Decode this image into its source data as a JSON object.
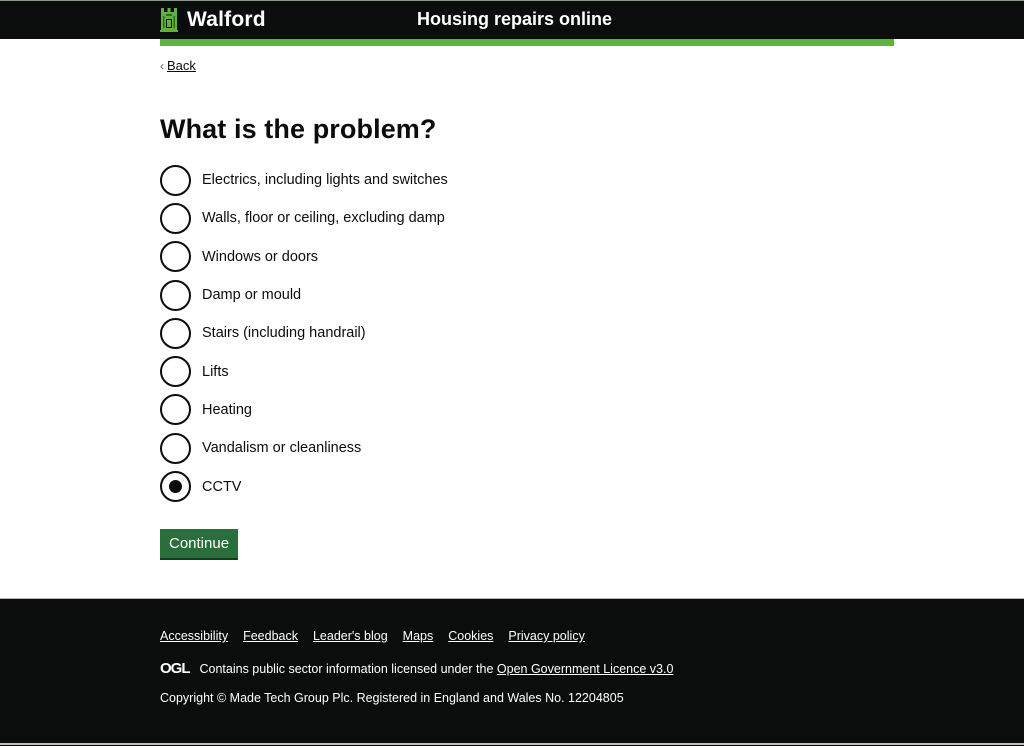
{
  "header": {
    "brand": "Walford",
    "service_name": "Housing repairs online",
    "accent_color": "#5fb33c"
  },
  "back_link": {
    "label": "Back"
  },
  "question": {
    "title": "What is the problem?",
    "options": [
      {
        "label": "Electrics, including lights and switches",
        "checked": false
      },
      {
        "label": "Walls, floor or ceiling, excluding damp",
        "checked": false
      },
      {
        "label": "Windows or doors",
        "checked": false
      },
      {
        "label": "Damp or mould",
        "checked": false
      },
      {
        "label": "Stairs (including handrail)",
        "checked": false
      },
      {
        "label": "Lifts",
        "checked": false
      },
      {
        "label": "Heating",
        "checked": false
      },
      {
        "label": "Vandalism or cleanliness",
        "checked": false
      },
      {
        "label": "CCTV",
        "checked": true
      }
    ],
    "selected": "CCTV"
  },
  "continue_button": {
    "label": "Continue",
    "color": "#2a6e3c"
  },
  "footer": {
    "links": [
      {
        "label": "Accessibility"
      },
      {
        "label": "Feedback"
      },
      {
        "label": "Leader's blog"
      },
      {
        "label": "Maps"
      },
      {
        "label": "Cookies"
      },
      {
        "label": "Privacy policy"
      }
    ],
    "ogl_logo": "OGL",
    "licence_text": "Contains public sector information licensed under the",
    "licence_link": "Open Government Licence v3.0",
    "copyright": "Copyright © Made Tech Group Plc. Registered in England and Wales No. 12204805"
  }
}
